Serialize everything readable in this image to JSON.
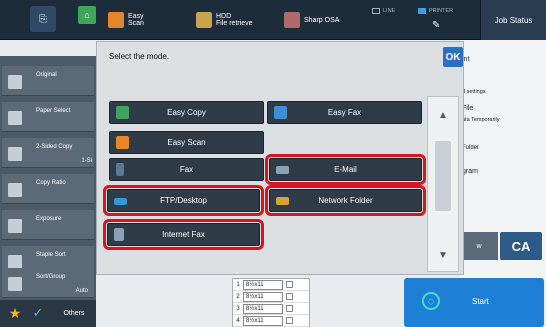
{
  "topbar": {
    "easy_scan": "Easy\nScan",
    "hdd": "HDD\nFile retrieve",
    "sharp_osa": "Sharp OSA",
    "line": "LINE",
    "printer": "PRINTER",
    "job_status": "Job Status"
  },
  "sidebar": {
    "items": [
      {
        "label": "Original",
        "value": ""
      },
      {
        "label": "Paper Select",
        "value": ""
      },
      {
        "label": "2-Sided Copy",
        "value": "1-Si"
      },
      {
        "label": "Copy Ratio",
        "value": ""
      },
      {
        "label": "Exposure",
        "value": ""
      },
      {
        "label": "Staple Sort",
        "value": ""
      },
      {
        "label": "Sort/Group",
        "value": "Auto"
      }
    ],
    "others": "Others"
  },
  "right_panel": {
    "texts": [
      "int",
      "d settings",
      "File",
      "ata Temporarily",
      "Folder",
      "gram"
    ],
    "gray_button": "w",
    "ca": "CA",
    "start": "Start"
  },
  "paper_list": [
    {
      "num": "1",
      "size": "8½x11"
    },
    {
      "num": "2",
      "size": "8½x11"
    },
    {
      "num": "3",
      "size": "8½x11"
    },
    {
      "num": "4",
      "size": "8½x11"
    }
  ],
  "dialog": {
    "title": "Select the mode.",
    "ok": "OK",
    "modes": {
      "easy_copy": "Easy Copy",
      "easy_fax": "Easy Fax",
      "easy_scan": "Easy Scan",
      "fax": "Fax",
      "email": "E-Mail",
      "ftp": "FTP/Desktop",
      "network_folder": "Network Folder",
      "internet_fax": "Internet Fax"
    }
  },
  "colors": {
    "highlight": "#d9141d",
    "button_bg": "#2f3b47",
    "accent_blue": "#2a6fc1"
  }
}
